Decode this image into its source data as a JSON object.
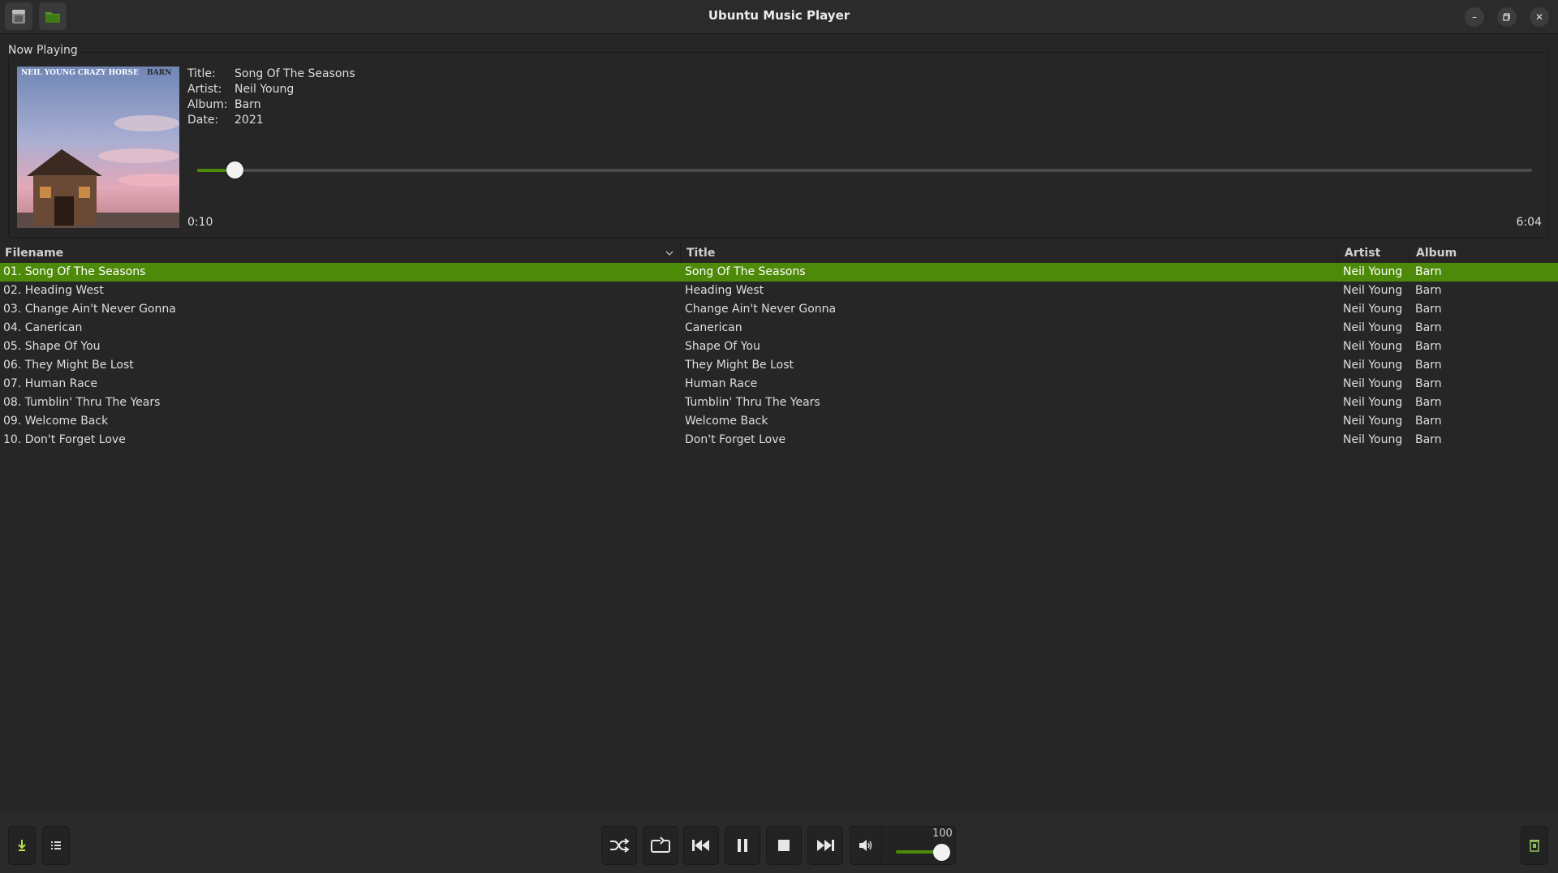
{
  "window": {
    "title": "Ubuntu Music Player"
  },
  "now_playing": {
    "label": "Now Playing",
    "cover_text": "NEIL YOUNG CRAZY HORSE",
    "cover_title": "BARN",
    "fields": [
      {
        "key": "Title:",
        "value": "Song Of The Seasons"
      },
      {
        "key": "Artist:",
        "value": "Neil Young"
      },
      {
        "key": "Album:",
        "value": "Barn"
      },
      {
        "key": "Date:",
        "value": "2021"
      }
    ],
    "elapsed": "0:10",
    "duration": "6:04",
    "progress_fraction": 0.028
  },
  "table": {
    "columns": [
      "Filename",
      "Title",
      "Artist",
      "Album"
    ],
    "rows": [
      {
        "filename": "01. Song Of The Seasons",
        "title": "Song Of The Seasons",
        "artist": "Neil Young",
        "album": "Barn"
      },
      {
        "filename": "02. Heading West",
        "title": "Heading West",
        "artist": "Neil Young",
        "album": "Barn"
      },
      {
        "filename": "03. Change Ain't Never Gonna",
        "title": "Change Ain't Never Gonna",
        "artist": "Neil Young",
        "album": "Barn"
      },
      {
        "filename": "04. Canerican",
        "title": "Canerican",
        "artist": "Neil Young",
        "album": "Barn"
      },
      {
        "filename": "05. Shape Of You",
        "title": "Shape Of You",
        "artist": "Neil Young",
        "album": "Barn"
      },
      {
        "filename": "06. They Might Be Lost",
        "title": "They Might Be Lost",
        "artist": "Neil Young",
        "album": "Barn"
      },
      {
        "filename": "07. Human Race",
        "title": "Human Race",
        "artist": "Neil Young",
        "album": "Barn"
      },
      {
        "filename": "08. Tumblin' Thru The Years",
        "title": "Tumblin' Thru The Years",
        "artist": "Neil Young",
        "album": "Barn"
      },
      {
        "filename": "09. Welcome Back",
        "title": "Welcome Back",
        "artist": "Neil Young",
        "album": "Barn"
      },
      {
        "filename": "10. Don't Forget Love",
        "title": "Don't Forget Love",
        "artist": "Neil Young",
        "album": "Barn"
      }
    ]
  },
  "volume": {
    "value": "100",
    "level_fraction": 1.0
  },
  "colors": {
    "accent": "#4e8a0a",
    "background": "#262626",
    "text": "#dedede"
  }
}
